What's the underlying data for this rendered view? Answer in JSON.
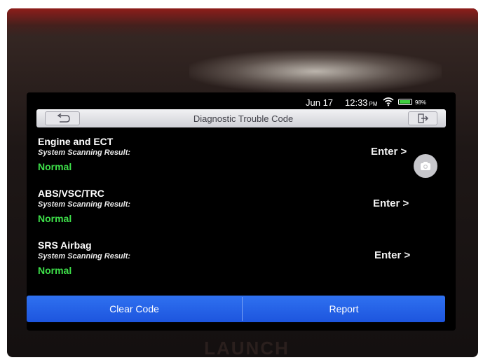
{
  "status_bar": {
    "date": "Jun 17",
    "time": "12:33",
    "ampm": "PM",
    "battery_percent": "98%",
    "icons": [
      "wifi-icon",
      "battery-icon"
    ]
  },
  "header": {
    "title": "Diagnostic Trouble Code",
    "back_icon": "back-arrow-icon",
    "exit_icon": "exit-icon",
    "background": "#e4e4e8"
  },
  "systems": [
    {
      "name": "Engine and ECT",
      "label": "System Scanning Result:",
      "result": "Normal",
      "action": "Enter >"
    },
    {
      "name": "ABS/VSC/TRC",
      "label": "System Scanning Result:",
      "result": "Normal",
      "action": "Enter >"
    },
    {
      "name": "SRS Airbag",
      "label": "System Scanning Result:",
      "result": "Normal",
      "action": "Enter >"
    }
  ],
  "floating_action": {
    "icon": "camera-icon"
  },
  "footer": {
    "clear_label": "Clear Code",
    "report_label": "Report",
    "color": "#2563eb"
  },
  "device": {
    "brand": "LAUNCH"
  },
  "colors": {
    "result_normal": "#3ee04a",
    "screen_bg": "#000000"
  }
}
